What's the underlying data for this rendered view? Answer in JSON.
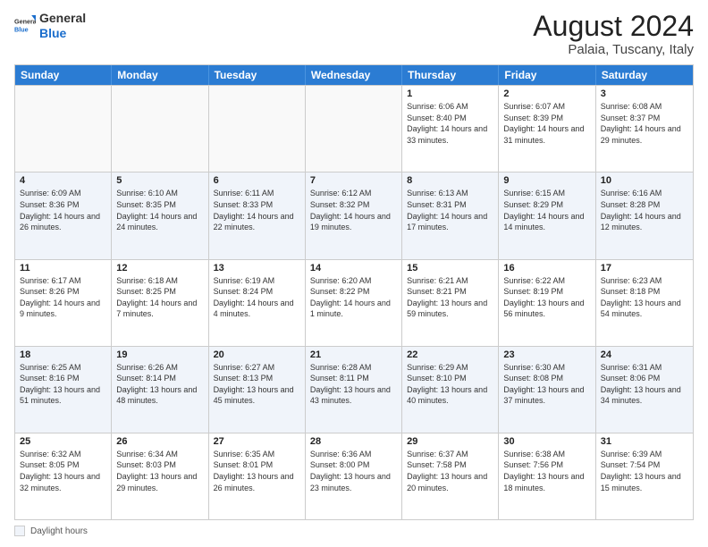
{
  "logo": {
    "general": "General",
    "blue": "Blue"
  },
  "title": "August 2024",
  "subtitle": "Palaia, Tuscany, Italy",
  "days": [
    "Sunday",
    "Monday",
    "Tuesday",
    "Wednesday",
    "Thursday",
    "Friday",
    "Saturday"
  ],
  "weeks": [
    [
      {
        "day": "",
        "text": ""
      },
      {
        "day": "",
        "text": ""
      },
      {
        "day": "",
        "text": ""
      },
      {
        "day": "",
        "text": ""
      },
      {
        "day": "1",
        "text": "Sunrise: 6:06 AM\nSunset: 8:40 PM\nDaylight: 14 hours and 33 minutes."
      },
      {
        "day": "2",
        "text": "Sunrise: 6:07 AM\nSunset: 8:39 PM\nDaylight: 14 hours and 31 minutes."
      },
      {
        "day": "3",
        "text": "Sunrise: 6:08 AM\nSunset: 8:37 PM\nDaylight: 14 hours and 29 minutes."
      }
    ],
    [
      {
        "day": "4",
        "text": "Sunrise: 6:09 AM\nSunset: 8:36 PM\nDaylight: 14 hours and 26 minutes."
      },
      {
        "day": "5",
        "text": "Sunrise: 6:10 AM\nSunset: 8:35 PM\nDaylight: 14 hours and 24 minutes."
      },
      {
        "day": "6",
        "text": "Sunrise: 6:11 AM\nSunset: 8:33 PM\nDaylight: 14 hours and 22 minutes."
      },
      {
        "day": "7",
        "text": "Sunrise: 6:12 AM\nSunset: 8:32 PM\nDaylight: 14 hours and 19 minutes."
      },
      {
        "day": "8",
        "text": "Sunrise: 6:13 AM\nSunset: 8:31 PM\nDaylight: 14 hours and 17 minutes."
      },
      {
        "day": "9",
        "text": "Sunrise: 6:15 AM\nSunset: 8:29 PM\nDaylight: 14 hours and 14 minutes."
      },
      {
        "day": "10",
        "text": "Sunrise: 6:16 AM\nSunset: 8:28 PM\nDaylight: 14 hours and 12 minutes."
      }
    ],
    [
      {
        "day": "11",
        "text": "Sunrise: 6:17 AM\nSunset: 8:26 PM\nDaylight: 14 hours and 9 minutes."
      },
      {
        "day": "12",
        "text": "Sunrise: 6:18 AM\nSunset: 8:25 PM\nDaylight: 14 hours and 7 minutes."
      },
      {
        "day": "13",
        "text": "Sunrise: 6:19 AM\nSunset: 8:24 PM\nDaylight: 14 hours and 4 minutes."
      },
      {
        "day": "14",
        "text": "Sunrise: 6:20 AM\nSunset: 8:22 PM\nDaylight: 14 hours and 1 minute."
      },
      {
        "day": "15",
        "text": "Sunrise: 6:21 AM\nSunset: 8:21 PM\nDaylight: 13 hours and 59 minutes."
      },
      {
        "day": "16",
        "text": "Sunrise: 6:22 AM\nSunset: 8:19 PM\nDaylight: 13 hours and 56 minutes."
      },
      {
        "day": "17",
        "text": "Sunrise: 6:23 AM\nSunset: 8:18 PM\nDaylight: 13 hours and 54 minutes."
      }
    ],
    [
      {
        "day": "18",
        "text": "Sunrise: 6:25 AM\nSunset: 8:16 PM\nDaylight: 13 hours and 51 minutes."
      },
      {
        "day": "19",
        "text": "Sunrise: 6:26 AM\nSunset: 8:14 PM\nDaylight: 13 hours and 48 minutes."
      },
      {
        "day": "20",
        "text": "Sunrise: 6:27 AM\nSunset: 8:13 PM\nDaylight: 13 hours and 45 minutes."
      },
      {
        "day": "21",
        "text": "Sunrise: 6:28 AM\nSunset: 8:11 PM\nDaylight: 13 hours and 43 minutes."
      },
      {
        "day": "22",
        "text": "Sunrise: 6:29 AM\nSunset: 8:10 PM\nDaylight: 13 hours and 40 minutes."
      },
      {
        "day": "23",
        "text": "Sunrise: 6:30 AM\nSunset: 8:08 PM\nDaylight: 13 hours and 37 minutes."
      },
      {
        "day": "24",
        "text": "Sunrise: 6:31 AM\nSunset: 8:06 PM\nDaylight: 13 hours and 34 minutes."
      }
    ],
    [
      {
        "day": "25",
        "text": "Sunrise: 6:32 AM\nSunset: 8:05 PM\nDaylight: 13 hours and 32 minutes."
      },
      {
        "day": "26",
        "text": "Sunrise: 6:34 AM\nSunset: 8:03 PM\nDaylight: 13 hours and 29 minutes."
      },
      {
        "day": "27",
        "text": "Sunrise: 6:35 AM\nSunset: 8:01 PM\nDaylight: 13 hours and 26 minutes."
      },
      {
        "day": "28",
        "text": "Sunrise: 6:36 AM\nSunset: 8:00 PM\nDaylight: 13 hours and 23 minutes."
      },
      {
        "day": "29",
        "text": "Sunrise: 6:37 AM\nSunset: 7:58 PM\nDaylight: 13 hours and 20 minutes."
      },
      {
        "day": "30",
        "text": "Sunrise: 6:38 AM\nSunset: 7:56 PM\nDaylight: 13 hours and 18 minutes."
      },
      {
        "day": "31",
        "text": "Sunrise: 6:39 AM\nSunset: 7:54 PM\nDaylight: 13 hours and 15 minutes."
      }
    ]
  ],
  "legend": {
    "box_label": "Daylight hours"
  }
}
